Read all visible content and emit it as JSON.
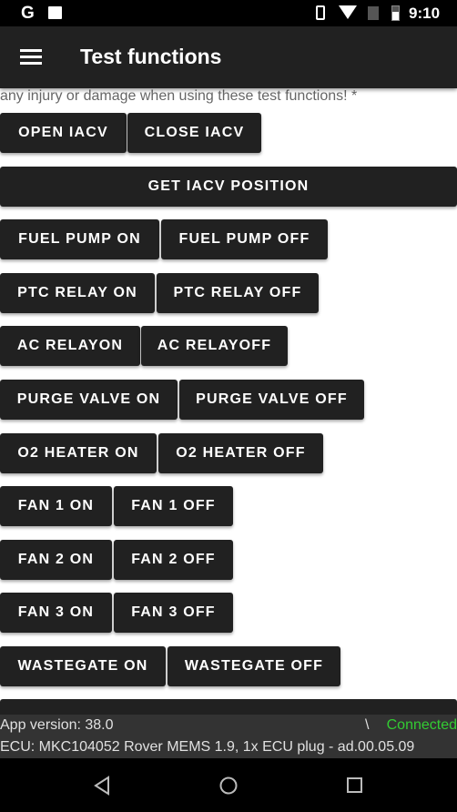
{
  "status_bar": {
    "time": "9:10",
    "left_icons": [
      "google-icon",
      "image-icon"
    ],
    "right_icons": [
      "vibrate-icon",
      "wifi-icon",
      "no-sim-icon",
      "battery-icon"
    ]
  },
  "header": {
    "title": "Test functions"
  },
  "warning_text": "any injury or damage when using these test functions! *",
  "rows": [
    [
      {
        "label": "OPEN IACV"
      },
      {
        "label": "CLOSE IACV"
      }
    ],
    [
      {
        "label": "GET IACV POSITION"
      }
    ],
    [
      {
        "label": "FUEL PUMP ON"
      },
      {
        "label": "FUEL PUMP OFF"
      }
    ],
    [
      {
        "label": "PTC RELAY ON"
      },
      {
        "label": "PTC RELAY OFF"
      }
    ],
    [
      {
        "label": "AC RELAYON"
      },
      {
        "label": "AC RELAYOFF"
      }
    ],
    [
      {
        "label": "PURGE VALVE ON"
      },
      {
        "label": "PURGE VALVE OFF"
      }
    ],
    [
      {
        "label": "O2 HEATER ON"
      },
      {
        "label": "O2 HEATER OFF"
      }
    ],
    [
      {
        "label": "FAN 1 ON"
      },
      {
        "label": "FAN 1 OFF"
      }
    ],
    [
      {
        "label": "FAN 2 ON"
      },
      {
        "label": "FAN 2 OFF"
      }
    ],
    [
      {
        "label": "FAN 3 ON"
      },
      {
        "label": "FAN 3 OFF"
      }
    ],
    [
      {
        "label": "WASTEGATE ON"
      },
      {
        "label": "WASTEGATE OFF"
      }
    ]
  ],
  "footer": {
    "app_version": "App version: 38.0",
    "spinner": "\\",
    "connection": "Connected",
    "connection_color": "#33cc33",
    "ecu": "ECU: MKC104052 Rover MEMS 1.9, 1x ECU plug - ad.00.05.09"
  }
}
